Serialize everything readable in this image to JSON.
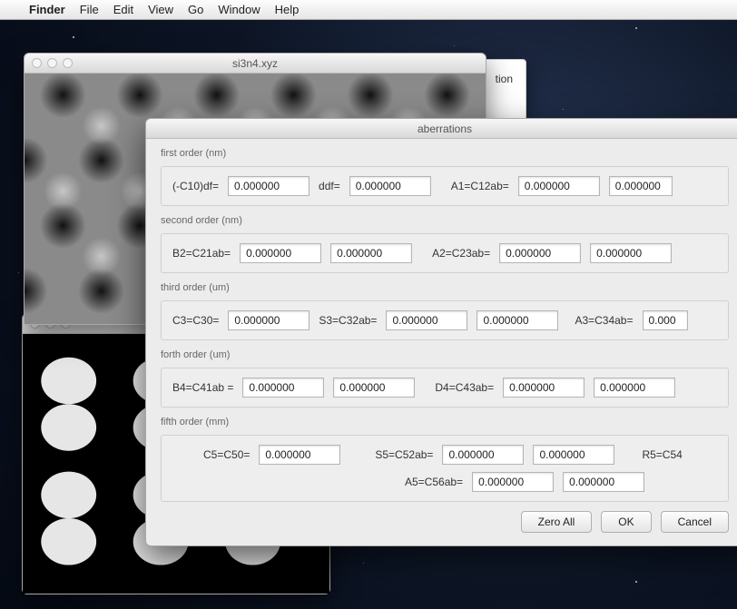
{
  "menubar": {
    "app": "Finder",
    "items": [
      "File",
      "Edit",
      "View",
      "Go",
      "Window",
      "Help"
    ]
  },
  "win_sim": {
    "title": "si3n4.xyz"
  },
  "win_peek": {
    "fragment": "tion"
  },
  "dialog": {
    "title": "aberrations",
    "groups": {
      "first": {
        "label": "first order (nm)",
        "c10_lbl": "(-C10)df=",
        "ddf_lbl": "ddf=",
        "a1_lbl": "A1=C12ab="
      },
      "second": {
        "label": "second order (nm)",
        "b2_lbl": "B2=C21ab=",
        "a2_lbl": "A2=C23ab="
      },
      "third": {
        "label": "third order (um)",
        "c3_lbl": "C3=C30=",
        "s3_lbl": "S3=C32ab=",
        "a3_lbl": "A3=C34ab="
      },
      "forth": {
        "label": "forth order (um)",
        "b4_lbl": "B4=C41ab =",
        "d4_lbl": "D4=C43ab="
      },
      "fifth": {
        "label": "fifth order (mm)",
        "c5_lbl": "C5=C50=",
        "s5_lbl": "S5=C52ab=",
        "a5_lbl": "A5=C56ab=",
        "r5_lbl": "R5=C54"
      }
    },
    "values": {
      "c10": "0.000000",
      "ddf": "0.000000",
      "a1a": "0.000000",
      "a1b": "0.000000",
      "b2a": "0.000000",
      "b2b": "0.000000",
      "a2a": "0.000000",
      "a2b": "0.000000",
      "c3": "0.000000",
      "s3a": "0.000000",
      "s3b": "0.000000",
      "a3a": "0.000",
      "b4a": "0.000000",
      "b4b": "0.000000",
      "d4a": "0.000000",
      "d4b": "0.000000",
      "c5": "0.000000",
      "s5a": "0.000000",
      "s5b": "0.000000",
      "a5a": "0.000000",
      "a5b": "0.000000"
    },
    "buttons": {
      "zero": "Zero All",
      "ok": "OK",
      "cancel": "Cancel"
    }
  }
}
